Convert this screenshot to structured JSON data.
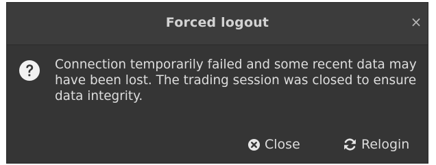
{
  "dialog": {
    "title": "Forced logout",
    "close_glyph": "×",
    "message": "Connection temporarily failed and some recent data may have been lost. The trading session was closed to ensure data integrity.",
    "icon": "question-circle-icon"
  },
  "buttons": {
    "close_label": "Close",
    "close_icon": "times-circle-icon",
    "relogin_label": "Relogin",
    "relogin_icon": "refresh-icon"
  },
  "colors": {
    "dialog_bg": "#353535",
    "titlebar_bg": "#3c3c3c",
    "text": "#dedede"
  }
}
